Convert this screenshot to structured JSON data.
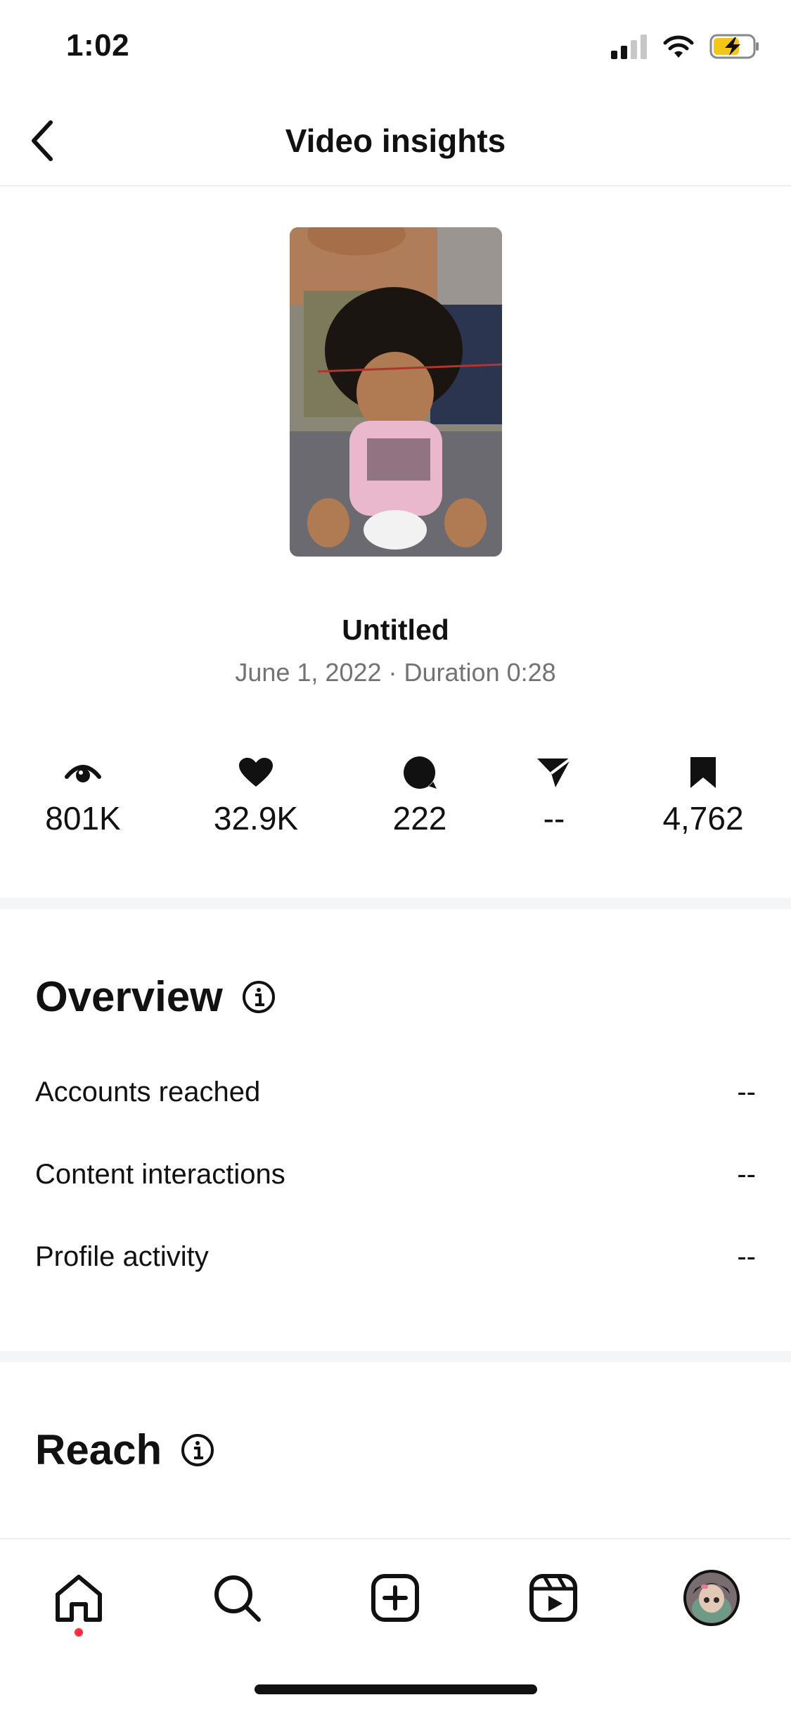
{
  "status_bar": {
    "time": "1:02"
  },
  "header": {
    "title": "Video insights"
  },
  "post": {
    "title": "Untitled",
    "meta": "June 1, 2022 · Duration 0:28"
  },
  "metrics": [
    {
      "name": "plays",
      "icon": "eye-icon",
      "value": "801K"
    },
    {
      "name": "likes",
      "icon": "heart-icon",
      "value": "32.9K"
    },
    {
      "name": "comments",
      "icon": "comment-icon",
      "value": "222"
    },
    {
      "name": "shares",
      "icon": "share-icon",
      "value": "--"
    },
    {
      "name": "saves",
      "icon": "bookmark-icon",
      "value": "4,762"
    }
  ],
  "overview": {
    "title": "Overview",
    "rows": [
      {
        "label": "Accounts reached",
        "value": "--"
      },
      {
        "label": "Content interactions",
        "value": "--"
      },
      {
        "label": "Profile activity",
        "value": "--"
      }
    ]
  },
  "reach": {
    "title": "Reach"
  },
  "bottom_nav": {
    "items": [
      "home-icon",
      "search-icon",
      "create-icon",
      "reels-icon",
      "profile-avatar"
    ],
    "active": "home-icon"
  },
  "colors": {
    "accent_dot": "#ff3040",
    "meta_gray": "#737373",
    "battery_yellow": "#f5c518"
  }
}
